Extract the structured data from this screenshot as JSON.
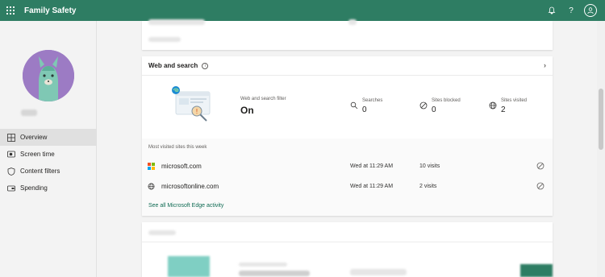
{
  "app": {
    "title": "Family Safety"
  },
  "topbar": {
    "help_label": "?"
  },
  "sidebar": {
    "items": [
      {
        "label": "Overview",
        "icon": "overview-icon"
      },
      {
        "label": "Screen time",
        "icon": "screen-time-icon"
      },
      {
        "label": "Content filters",
        "icon": "shield-icon"
      },
      {
        "label": "Spending",
        "icon": "wallet-icon"
      }
    ]
  },
  "web_card": {
    "title": "Web and search",
    "filter_label": "Web and search filter",
    "filter_value": "On",
    "stats": [
      {
        "label": "Searches",
        "value": "0",
        "icon": "search-icon"
      },
      {
        "label": "Sites blocked",
        "value": "0",
        "icon": "block-icon"
      },
      {
        "label": "Sites visited",
        "value": "2",
        "icon": "globe-icon"
      }
    ],
    "sites_title": "Most visited sites this week",
    "sites": [
      {
        "name": "microsoft.com",
        "time": "Wed at 11:29 AM",
        "visits": "10 visits",
        "icon": "microsoft-logo-icon"
      },
      {
        "name": "microsoftonline.com",
        "time": "Wed at 11:29 AM",
        "visits": "2 visits",
        "icon": "globe-icon"
      }
    ],
    "see_all": "See all Microsoft Edge activity"
  },
  "colors": {
    "header": "#2e7d63",
    "link": "#0f6b53",
    "profile_bg": "#9c7bc4"
  }
}
